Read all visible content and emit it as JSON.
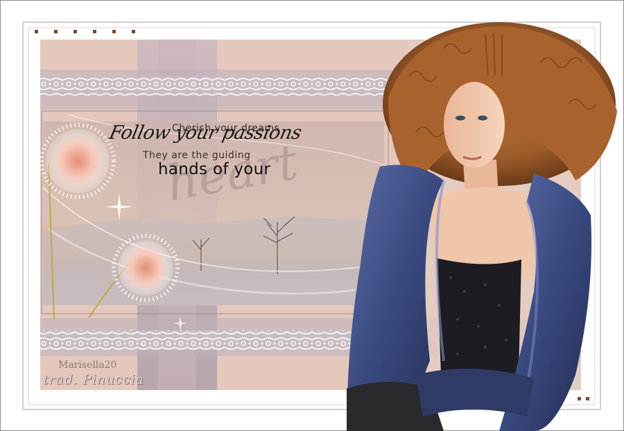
{
  "poem": {
    "line1": "Cherish your dreams",
    "line2": "Follow your passions",
    "line3": "They are the guiding",
    "line4": "hands of your",
    "watermark": "heart"
  },
  "credits": {
    "author": "Marisella20",
    "translator": "trad. Pinuccia"
  },
  "colors": {
    "frame_bg": "#ffffff",
    "card_bg": "#e4c8bc",
    "band_shade": "#b8a8b8",
    "lace": "#f2efee",
    "jacket": "#3a4a80",
    "hair": "#9a5a2a",
    "flower": "#f6c6b8",
    "sunset": "#e6a656"
  }
}
